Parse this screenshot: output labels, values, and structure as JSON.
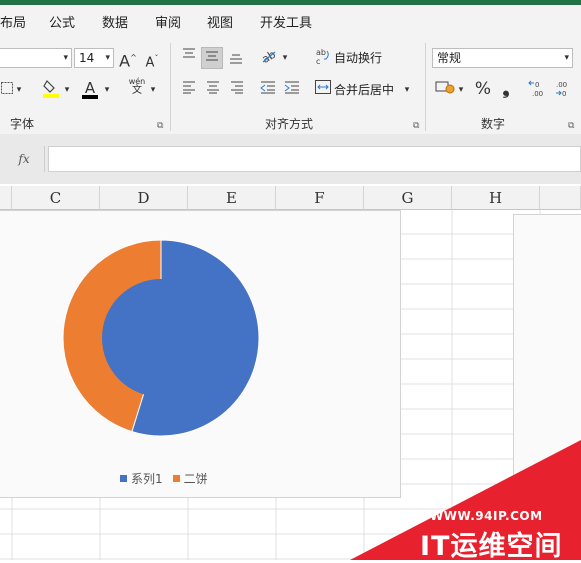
{
  "menu": {
    "items": [
      "布局",
      "公式",
      "数据",
      "审阅",
      "视图",
      "开发工具"
    ]
  },
  "ribbon": {
    "font_group": {
      "label": "字体",
      "font_size": "14",
      "grow_font": "A",
      "shrink_font": "A",
      "font_color_glyph": "A",
      "phonetic_top": "wén",
      "phonetic_bottom": "文"
    },
    "alignment_group": {
      "label": "对齐方式",
      "wrap_text_label": "自动换行",
      "merge_center_label": "合并后居中"
    },
    "number_group": {
      "label": "数字",
      "format_value": "常规",
      "percent": "%",
      "comma": "❟",
      "increase_decimal": "←0 .00",
      "decrease_decimal": ".00 →0"
    }
  },
  "formula_bar": {
    "fx": "fx",
    "value": ""
  },
  "columns": [
    "C",
    "D",
    "E",
    "F",
    "G",
    "H"
  ],
  "chart_data": {
    "type": "pie",
    "title": "",
    "series": [
      {
        "name": "系列1",
        "values": [
          0.548
        ],
        "color": "#4472C4"
      },
      {
        "name": "二饼",
        "values": [
          0.452
        ],
        "color": "#ED7D31"
      }
    ],
    "labels": [
      "系列1",
      "二饼"
    ],
    "values": [
      54.8,
      45.2
    ],
    "colors": [
      "#4472C4",
      "#ED7D31"
    ],
    "inner_ring": {
      "color": "#4472C4",
      "note_values": [
        1
      ]
    },
    "legend_position": "bottom"
  },
  "watermark": {
    "url": "WWW.94IP.COM",
    "name": "IT运维空间",
    "color": "#E8212E"
  }
}
